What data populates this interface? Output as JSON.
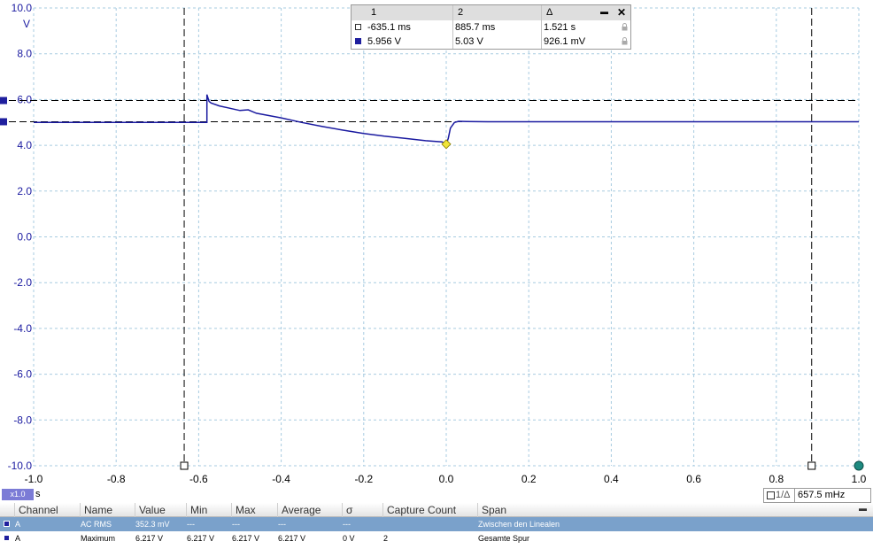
{
  "chart_data": {
    "type": "line",
    "x_axis": {
      "min": -1.0,
      "max": 1.0,
      "unit": "s",
      "tick_labels": [
        "-1.0",
        "-0.8",
        "-0.6",
        "-0.4",
        "-0.2",
        "0.0",
        "0.2",
        "0.4",
        "0.6",
        "0.8",
        "1.0"
      ]
    },
    "y_axis": {
      "min": -10.0,
      "max": 10.0,
      "unit": "V",
      "tick_labels": [
        "10.0",
        "8.0",
        "6.0",
        "4.0",
        "2.0",
        "0.0",
        "-2.0",
        "-4.0",
        "-6.0",
        "-8.0",
        "-10.0"
      ]
    },
    "grid": true,
    "series": [
      {
        "color": "#1a1aa0",
        "x": [
          -1.0,
          -0.58,
          -0.58,
          -0.575,
          -0.57,
          -0.55,
          -0.5,
          -0.48,
          -0.46,
          -0.4,
          -0.35,
          -0.3,
          -0.25,
          -0.2,
          -0.15,
          -0.1,
          -0.05,
          -0.01,
          0.0,
          0.005,
          0.01,
          0.02,
          0.03,
          0.05,
          0.1,
          1.0
        ],
        "y": [
          5.0,
          5.0,
          6.217,
          5.92,
          5.85,
          5.72,
          5.52,
          5.55,
          5.4,
          5.2,
          5.0,
          4.82,
          4.66,
          4.52,
          4.4,
          4.3,
          4.2,
          4.15,
          4.05,
          4.3,
          4.75,
          5.0,
          5.05,
          5.04,
          5.03,
          5.03
        ]
      }
    ],
    "rulers": {
      "vertical": [
        -0.6351,
        0.8857
      ],
      "horizontal": [
        5.956,
        5.03
      ]
    },
    "markers": {
      "trigger": {
        "x": 0.0,
        "y": 4.05,
        "color": "#f0e43a"
      }
    }
  },
  "ruler_table": {
    "headers": [
      "1",
      "2",
      "Δ"
    ],
    "rows": [
      {
        "v1": "-635.1 ms",
        "v2": "885.7 ms",
        "d": "1.521 s"
      },
      {
        "v1": "5.956 V",
        "v2": "5.03 V",
        "d": "926.1 mV"
      }
    ],
    "minimize_glyph": "▬",
    "close_glyph": "✕"
  },
  "x_zoom": "x1.0",
  "x_unit": "s",
  "freq": {
    "label": "1/Δ",
    "value": "657.5 mHz"
  },
  "measurements": {
    "headers": [
      "Channel",
      "Name",
      "Value",
      "Min",
      "Max",
      "Average",
      "σ",
      "Capture Count",
      "Span"
    ],
    "rows": [
      [
        "A",
        "AC RMS",
        "352.3 mV",
        "---",
        "---",
        "---",
        "---",
        "",
        "Zwischen den Linealen"
      ],
      [
        "A",
        "Maximum",
        "6.217 V",
        "6.217 V",
        "6.217 V",
        "6.217 V",
        "0 V",
        "2",
        "Gesamte Spur"
      ]
    ],
    "collapse_glyph": "▬"
  }
}
